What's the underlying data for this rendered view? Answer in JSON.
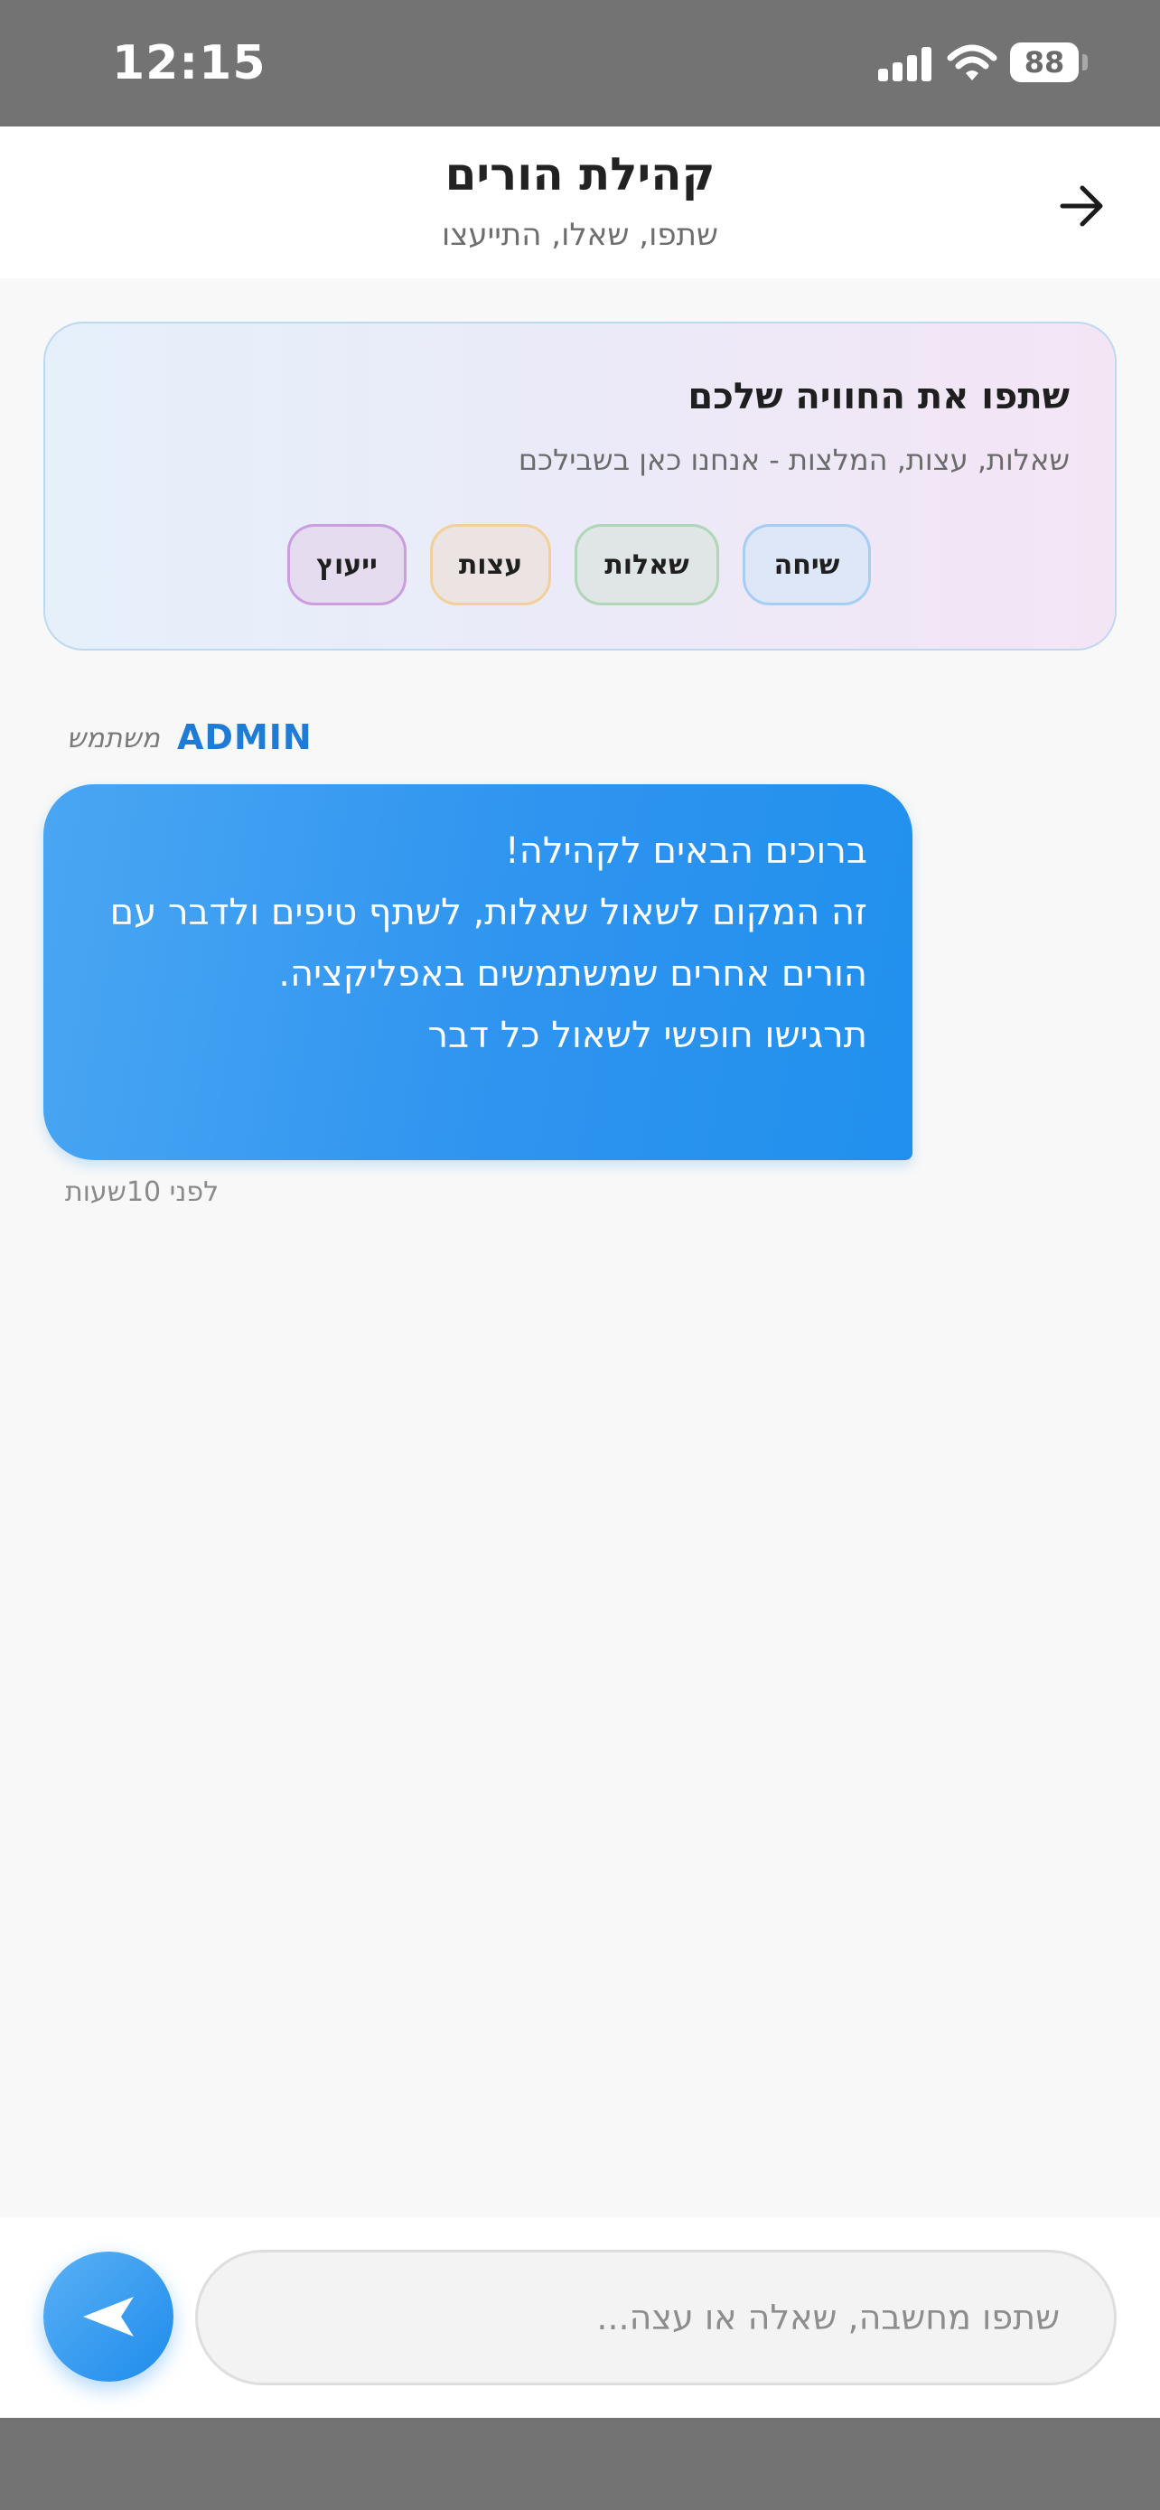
{
  "status_bar": {
    "time": "12:15",
    "battery": "88"
  },
  "header": {
    "title": "קהילת הורים",
    "subtitle": "שתפו, שאלו, התייעצו"
  },
  "info_card": {
    "title": "שתפו את החוויה שלכם",
    "subtitle": "שאלות, עצות, המלצות - אנחנו כאן בשבילכם",
    "chips": [
      "שיחה",
      "שאלות",
      "עצות",
      "ייעוץ"
    ]
  },
  "messages": [
    {
      "author": "ADMIN",
      "role": "משתמש",
      "text": "ברוכים הבאים לקהילה!\nזה המקום לשאול שאלות, לשתף טיפים ולדבר עם הורים אחרים שמשתמשים באפליקציה.\nתרגישו חופשי לשאול כל דבר",
      "time": "לפני 10שעות"
    }
  ],
  "composer": {
    "placeholder": "שתפו מחשבה, שאלה או עצה..."
  },
  "colors": {
    "accent": "#2190ee",
    "author": "#1e7bd6",
    "system_bar": "#737373"
  },
  "icons": {
    "back": "arrow-right-icon",
    "send": "send-icon",
    "signal": "signal-icon",
    "wifi": "wifi-icon",
    "battery": "battery-icon"
  }
}
